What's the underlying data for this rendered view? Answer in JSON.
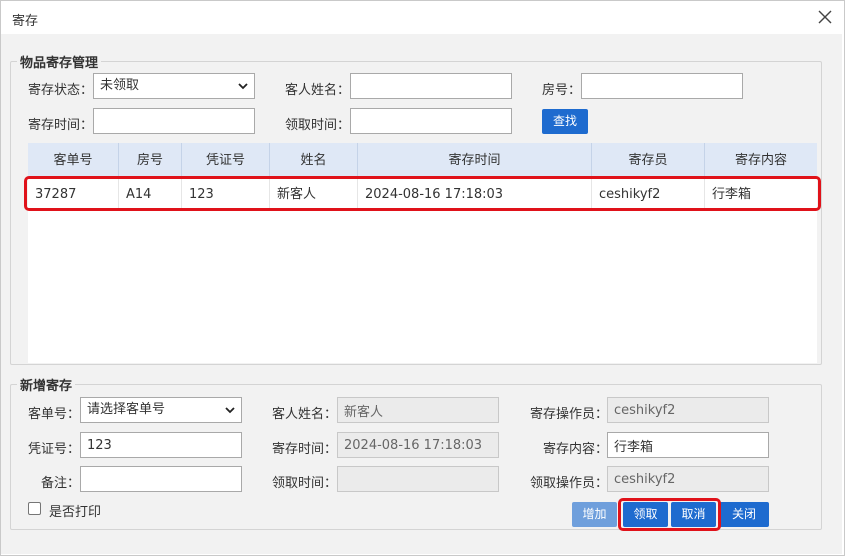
{
  "window": {
    "title": "寄存"
  },
  "search": {
    "legend": "物品寄存管理",
    "status_label": "寄存状态：",
    "status_value": "未领取",
    "guest_name_label": "客人姓名：",
    "guest_name_value": "",
    "room_label": "房号：",
    "room_value": "",
    "deposit_time_label": "寄存时间：",
    "deposit_time_value": "",
    "pickup_time_label": "领取时间：",
    "pickup_time_value": "",
    "find_button": "查找"
  },
  "table": {
    "columns": [
      "客单号",
      "房号",
      "凭证号",
      "姓名",
      "寄存时间",
      "寄存员",
      "寄存内容"
    ],
    "rows": [
      [
        "37287",
        "A14",
        "123",
        "新客人",
        "2024-08-16 17:18:03",
        "ceshikyf2",
        "行李箱"
      ]
    ]
  },
  "form": {
    "legend": "新增寄存",
    "order_label": "客单号：",
    "order_placeholder": "请选择客单号",
    "guest_name_label": "客人姓名：",
    "guest_name_value": "新客人",
    "operator_label": "寄存操作员：",
    "operator_value": "ceshikyf2",
    "voucher_label": "凭证号：",
    "voucher_value": "123",
    "deposit_time_label": "寄存时间：",
    "deposit_time_value": "2024-08-16 17:18:03",
    "content_label": "寄存内容：",
    "content_value": "行李箱",
    "note_label": "备注：",
    "note_value": "",
    "pickup_time_label": "领取时间：",
    "pickup_time_value": "",
    "pickup_operator_label": "领取操作员：",
    "pickup_operator_value": "ceshikyf2",
    "print_label": "是否打印",
    "print_checked": false,
    "buttons": {
      "add": "增加",
      "pickup": "领取",
      "cancel": "取消",
      "close": "关闭"
    }
  },
  "icons": {
    "close": "close-icon",
    "dropdown": "chevron-down-icon"
  },
  "colors": {
    "primary_button": "#1e6bcf",
    "disabled_button": "#6f9fdc",
    "highlight": "#e0121a",
    "table_header": "#dfe8f6"
  }
}
